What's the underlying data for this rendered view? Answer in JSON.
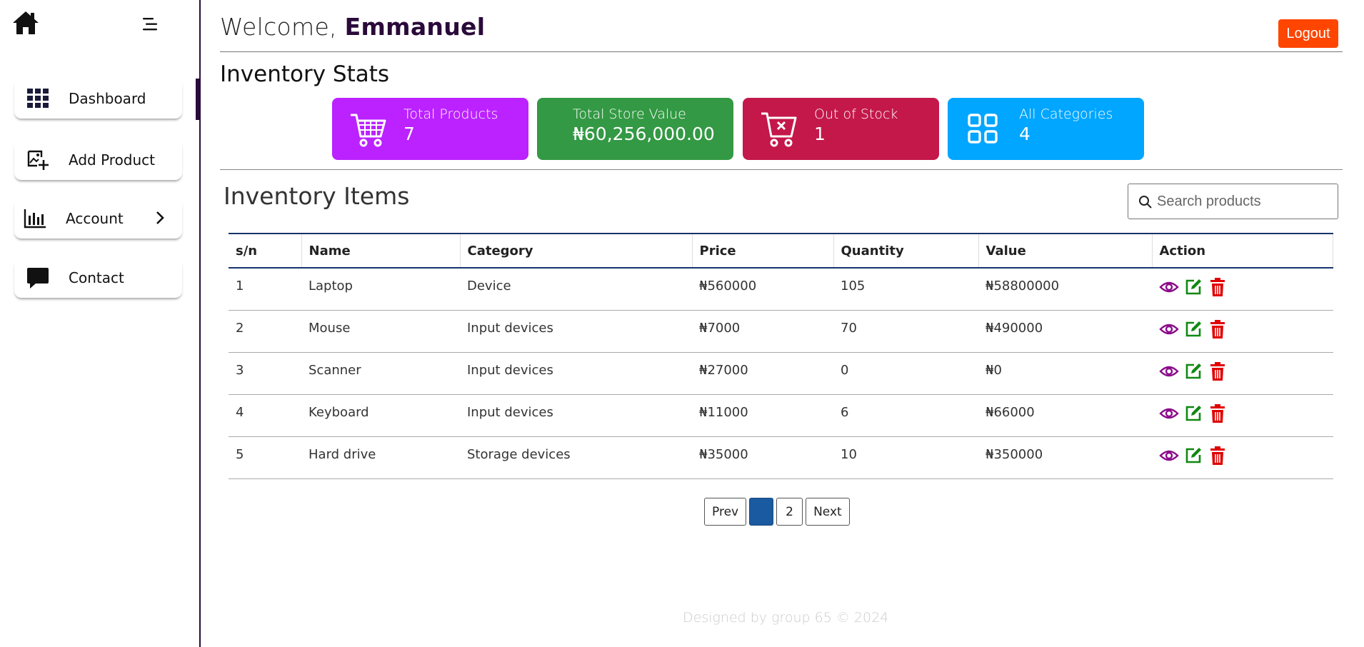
{
  "sidebar": {
    "items": [
      {
        "label": "Dashboard",
        "icon": "grid-icon"
      },
      {
        "label": "Add Product",
        "icon": "add-image-icon"
      },
      {
        "label": "Account",
        "icon": "chart-icon"
      },
      {
        "label": "Contact",
        "icon": "chat-icon"
      }
    ]
  },
  "header": {
    "welcome_prefix": "Welcome,",
    "username": "Emmanuel",
    "logout_label": "Logout"
  },
  "stats": {
    "title": "Inventory Stats",
    "cards": [
      {
        "label": "Total Products",
        "value": "7",
        "color": "#bb22ff",
        "icon": "cart-icon"
      },
      {
        "label": "Total Store Value",
        "value": "₦60,256,000.00",
        "color": "#339944"
      },
      {
        "label": "Out of Stock",
        "value": "1",
        "color": "#c4184a",
        "icon": "cart-x-icon"
      },
      {
        "label": "All Categories",
        "value": "4",
        "color": "#00a6ff",
        "icon": "categories-icon"
      }
    ]
  },
  "inventory": {
    "title": "Inventory Items",
    "search_placeholder": "Search products",
    "columns": [
      "s/n",
      "Name",
      "Category",
      "Price",
      "Quantity",
      "Value",
      "Action"
    ],
    "rows": [
      {
        "sn": "1",
        "name": "Laptop",
        "category": "Device",
        "price": "₦560000",
        "quantity": "105",
        "value": "₦58800000"
      },
      {
        "sn": "2",
        "name": "Mouse",
        "category": "Input devices",
        "price": "₦7000",
        "quantity": "70",
        "value": "₦490000"
      },
      {
        "sn": "3",
        "name": "Scanner",
        "category": "Input devices",
        "price": "₦27000",
        "quantity": "0",
        "value": "₦0"
      },
      {
        "sn": "4",
        "name": "Keyboard",
        "category": "Input devices",
        "price": "₦11000",
        "quantity": "6",
        "value": "₦66000"
      },
      {
        "sn": "5",
        "name": "Hard drive",
        "category": "Storage devices",
        "price": "₦35000",
        "quantity": "10",
        "value": "₦350000"
      }
    ]
  },
  "pagination": {
    "prev_label": "Prev",
    "pages": [
      "1",
      "2"
    ],
    "current_page": "1",
    "next_label": "Next"
  },
  "footer": {
    "text": "Designed by group 65 © 2024"
  },
  "colors": {
    "accent": "#2a0a3a",
    "logout": "#ff4500",
    "view_icon": "#8b0a8b",
    "edit_icon": "#118811",
    "delete_icon": "#e00000",
    "active_page": "#1a5aa0"
  }
}
